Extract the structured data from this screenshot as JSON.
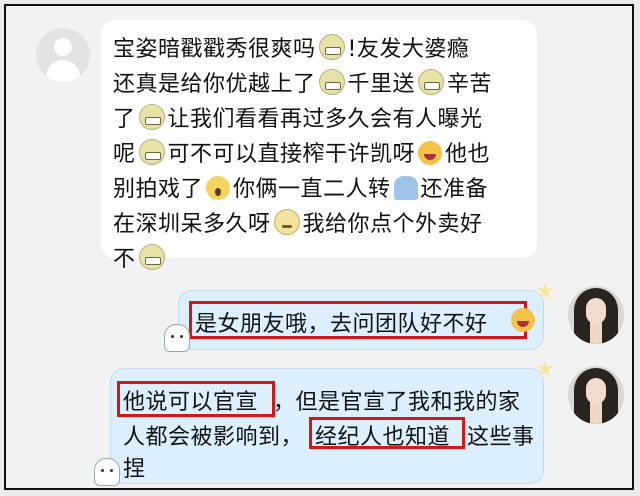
{
  "incoming_message": {
    "lines": [
      {
        "parts": [
          {
            "t": "宝姿暗戳戳秀很爽吗"
          },
          {
            "emoji": "grimace-emoji"
          },
          {
            "t": "!友发大婆瘾"
          }
        ]
      },
      {
        "parts": [
          {
            "t": "还真是给你优越上了"
          },
          {
            "emoji": "grimace-emoji"
          },
          {
            "t": "千里送"
          },
          {
            "emoji": "grimace-emoji"
          },
          {
            "t": "辛苦"
          }
        ]
      },
      {
        "parts": [
          {
            "t": "了"
          },
          {
            "emoji": "grimace-emoji"
          },
          {
            "t": "让我们看看再过多久会有人曝光"
          }
        ]
      },
      {
        "parts": [
          {
            "t": "呢"
          },
          {
            "emoji": "grimace-emoji"
          },
          {
            "t": "可不可以直接榨干许凯呀"
          },
          {
            "emoji": "laughing-emoji"
          },
          {
            "t": "他也"
          }
        ]
      },
      {
        "parts": [
          {
            "t": "别拍戏了"
          },
          {
            "emoji": "scream-emoji"
          },
          {
            "t": "你俩一直二人转"
          },
          {
            "emoji": "person-emoji"
          },
          {
            "t": "还准备"
          }
        ]
      },
      {
        "parts": [
          {
            "t": "在深圳呆多久呀"
          },
          {
            "emoji": "worried-emoji"
          },
          {
            "t": "我给你点个外卖好"
          }
        ]
      },
      {
        "parts": [
          {
            "t": "不"
          },
          {
            "emoji": "grimace-emoji"
          }
        ]
      }
    ]
  },
  "reply_1": {
    "text": "是女朋友哦，去问团队好不好",
    "emoji": "smile-emoji"
  },
  "reply_2": {
    "line1_a": "他说可以官宣",
    "line1_b": "，但是官宣了我和我的家",
    "line2_a": "人都会被影响到，",
    "line2_b": "经纪人也知道",
    "line2_c": "这些事",
    "line3": "捏"
  },
  "colors": {
    "page_bg": "#f2f2f2",
    "incoming_bubble": "#ffffff",
    "outgoing_bubble": "#dcefff",
    "highlight_box": "#d01818"
  }
}
